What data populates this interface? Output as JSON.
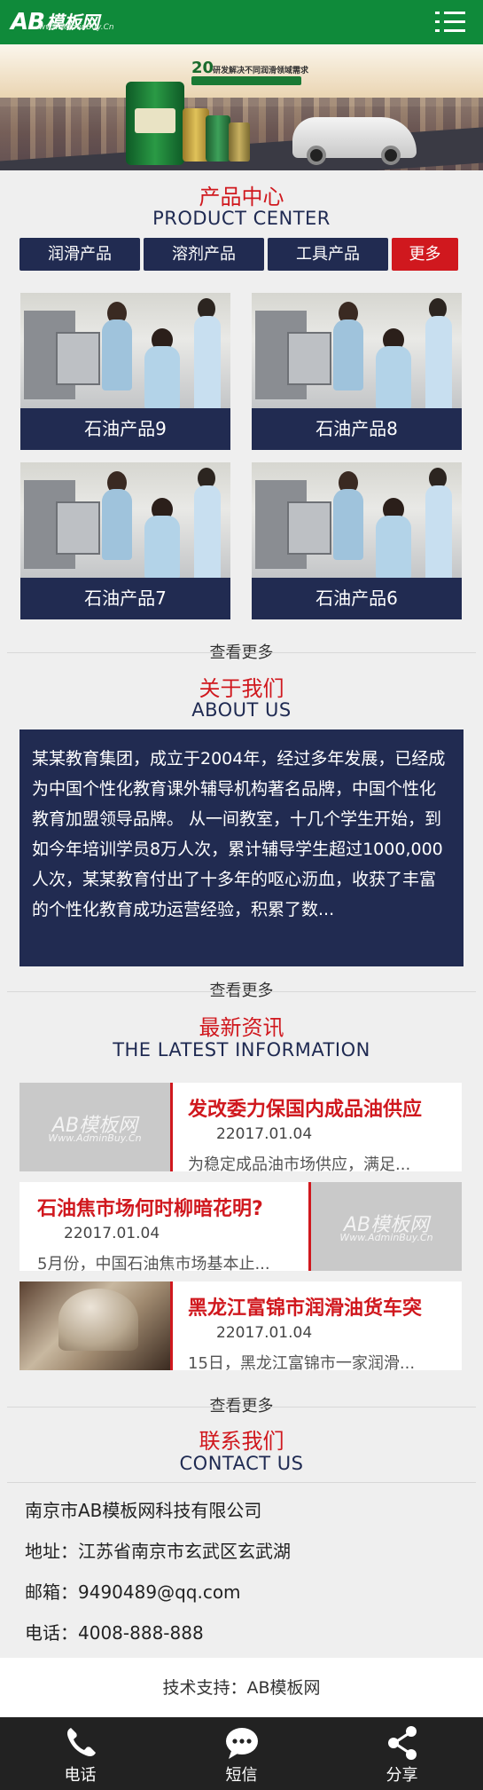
{
  "header": {
    "logo_main": "AB",
    "logo_cn": "模板网",
    "logo_url": "www.AdminBuy.Cn",
    "menu_icon": "menu-icon"
  },
  "banner": {
    "number": "20",
    "headline": "研发解决不同润滑领域需求"
  },
  "products": {
    "title": "产品中心",
    "subtitle": "PRODUCT CENTER",
    "tabs": [
      "润滑产品",
      "溶剂产品",
      "工具产品"
    ],
    "more_tab": "更多",
    "items": [
      "石油产品9",
      "石油产品8",
      "石油产品7",
      "石油产品6"
    ],
    "more_link": "查看更多"
  },
  "about": {
    "title": "关于我们",
    "subtitle": "ABOUT US",
    "body": "某某教育集团，成立于2004年，经过多年发展，已经成为中国个性化教育课外辅导机构著名品牌，中国个性化教育加盟领导品牌。 从一间教室，十几个学生开始，到如今年培训学员8万人次，累计辅导学生超过1000,000人次，某某教育付出了十多年的呕心沥血，收获了丰富的个性化教育成功运营经验，积累了数...",
    "more_link": "查看更多"
  },
  "news": {
    "title": "最新资讯",
    "subtitle": "THE LATEST INFORMATION",
    "watermark": "AB模板网",
    "watermark_url": "Www.AdminBuy.Cn",
    "items": [
      {
        "title": "发改委力保国内成品油供应",
        "date": "22017.01.04",
        "summary": "为稳定成品油市场供应，满足..."
      },
      {
        "title": "石油焦市场何时柳暗花明?",
        "date": "22017.01.04",
        "summary": "5月份，中国石油焦市场基本止..."
      },
      {
        "title": "黑龙江富锦市润滑油货车突",
        "date": "22017.01.04",
        "summary": "15日，黑龙江富锦市一家润滑..."
      }
    ],
    "more_link": "查看更多"
  },
  "contact": {
    "title": "联系我们",
    "subtitle": "CONTACT US",
    "company": "南京市AB模板网科技有限公司",
    "address": "地址：江苏省南京市玄武区玄武湖",
    "email": "邮箱：9490489@qq.com",
    "phone": "电话：4008-888-888"
  },
  "support": "技术支持：AB模板网",
  "footer": {
    "items": [
      {
        "label": "电话",
        "icon": "phone-icon"
      },
      {
        "label": "短信",
        "icon": "message-icon"
      },
      {
        "label": "分享",
        "icon": "share-icon"
      }
    ]
  }
}
